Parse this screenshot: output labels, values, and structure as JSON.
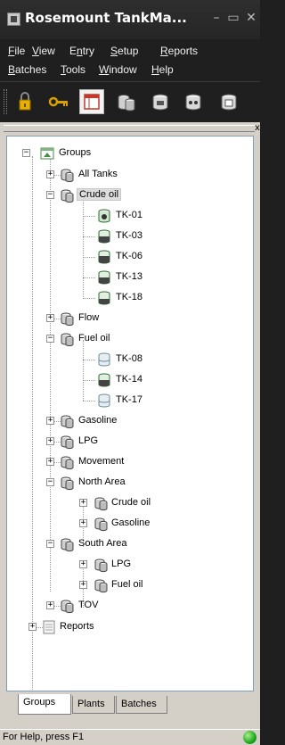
{
  "window": {
    "title": "Rosemount TankMa...",
    "minimize_glyph": "–",
    "maximize_glyph": "▭",
    "close_glyph": "✕",
    "icon": "app-icon"
  },
  "menu": [
    {
      "label": "File",
      "acc": "F",
      "rest": "ile"
    },
    {
      "label": "View",
      "acc": "V",
      "rest": "iew"
    },
    {
      "label": "Entry",
      "pre": "E",
      "acc": "n",
      "rest": "try"
    },
    {
      "label": "Setup",
      "acc": "S",
      "rest": "etup"
    },
    {
      "label": "Reports",
      "acc": "R",
      "rest": "eports"
    },
    {
      "label": "Batches",
      "acc": "B",
      "rest": "atches"
    },
    {
      "label": "Tools",
      "acc": "T",
      "rest": "ools"
    },
    {
      "label": "Window",
      "acc": "W",
      "rest": "indow"
    },
    {
      "label": "Help",
      "acc": "H",
      "rest": "elp"
    }
  ],
  "toolbar": {
    "buttons": [
      "lock-icon",
      "key-icon",
      "table-view-icon",
      "tank-group-icon",
      "tank-icon",
      "tank-alarm-icon",
      "tank-report-icon"
    ]
  },
  "panel": {
    "close_glyph": "x"
  },
  "tree": {
    "root": "Groups",
    "groups": {
      "all_tanks": "All Tanks",
      "crude_oil": "Crude oil",
      "crude_tanks": [
        "TK-01",
        "TK-03",
        "TK-06",
        "TK-13",
        "TK-18"
      ],
      "flow": "Flow",
      "fuel_oil": "Fuel oil",
      "fuel_tanks": [
        "TK-08",
        "TK-14",
        "TK-17"
      ],
      "gasoline": "Gasoline",
      "lpg": "LPG",
      "movement": "Movement",
      "north_area": "North Area",
      "north_children": [
        "Crude oil",
        "Gasoline"
      ],
      "south_area": "South Area",
      "south_children": [
        "LPG",
        "Fuel oil"
      ],
      "tov": "TOV"
    },
    "reports": "Reports",
    "expanded_glyph": "−",
    "collapsed_glyph": "+"
  },
  "tabs": [
    "Groups",
    "Plants",
    "Batches"
  ],
  "active_tab": "Groups",
  "status": {
    "text": "For Help, press F1",
    "indicator_color": "#1fa81f"
  }
}
